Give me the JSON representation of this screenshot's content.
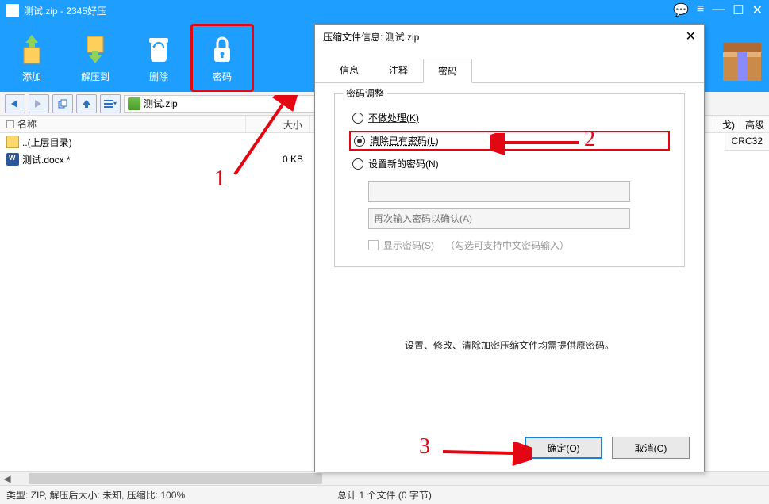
{
  "titlebar": {
    "caption": "测试.zip - 2345好压"
  },
  "toolbar": {
    "add": "添加",
    "extract": "解压到",
    "delete": "删除",
    "password": "密码"
  },
  "address": "测试.zip",
  "columns": {
    "name": "名称",
    "size": "大小",
    "crc": "CRC32",
    "ext1": "戈)",
    "ext2": "高级"
  },
  "rows": {
    "up": "..(上层目录)",
    "doc": "测试.docx *",
    "doc_size": "0 KB"
  },
  "status": {
    "left": "类型: ZIP, 解压后大小: 未知, 压缩比: 100%",
    "center": "总计 1 个文件 (0 字节)"
  },
  "dialog": {
    "title": "压缩文件信息: 测试.zip",
    "tabs": {
      "info": "信息",
      "comment": "注释",
      "password": "密码"
    },
    "group_legend": "密码调整",
    "opt_none": "不做处理(K)",
    "opt_clear": "清除已有密码(L)",
    "opt_set": "设置新的密码(N)",
    "confirm_placeholder": "再次输入密码以确认(A)",
    "show_pw": "显示密码(S)",
    "show_pw_hint": "（勾选可支持中文密码输入）",
    "note": "设置、修改、清除加密压缩文件均需提供原密码。",
    "ok": "确定(O)",
    "cancel": "取消(C)"
  },
  "annot": {
    "n1": "1",
    "n2": "2",
    "n3": "3"
  }
}
